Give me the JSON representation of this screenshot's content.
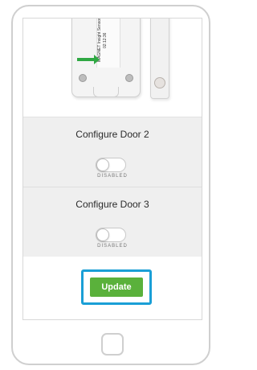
{
  "photo": {
    "sticker_text": "MAGNET  Insight Sensor  02:12:36"
  },
  "sections": [
    {
      "title": "Configure Door 2",
      "toggle_status": "DISABLED"
    },
    {
      "title": "Configure Door 3",
      "toggle_status": "DISABLED"
    }
  ],
  "update": {
    "label": "Update"
  },
  "colors": {
    "accent_highlight": "#1a9fd6",
    "update_button": "#5ab13b",
    "section_background": "#efefef",
    "arrow": "#2fa843"
  }
}
